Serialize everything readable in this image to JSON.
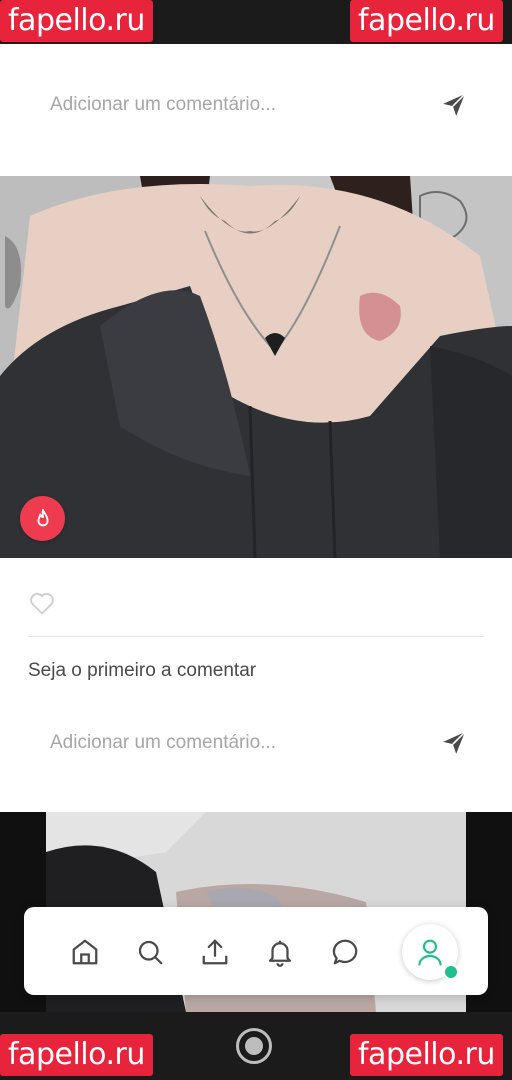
{
  "watermark": {
    "text": "fapello.ru"
  },
  "comments": {
    "placeholder": "Adicionar um comentário...",
    "first_comment_prompt": "Seja o primeiro a comentar"
  },
  "icons": {
    "send": "send-icon",
    "hot": "flame-icon",
    "like": "heart-icon",
    "home": "home-icon",
    "search": "search-icon",
    "upload": "upload-icon",
    "notifications": "bell-icon",
    "messages": "chat-icon",
    "profile": "user-icon"
  },
  "colors": {
    "accent_red": "#e8243c",
    "badge_red": "#ee3b4f",
    "online_green": "#1fbf8f",
    "icon_gray": "#4a4a4a"
  }
}
